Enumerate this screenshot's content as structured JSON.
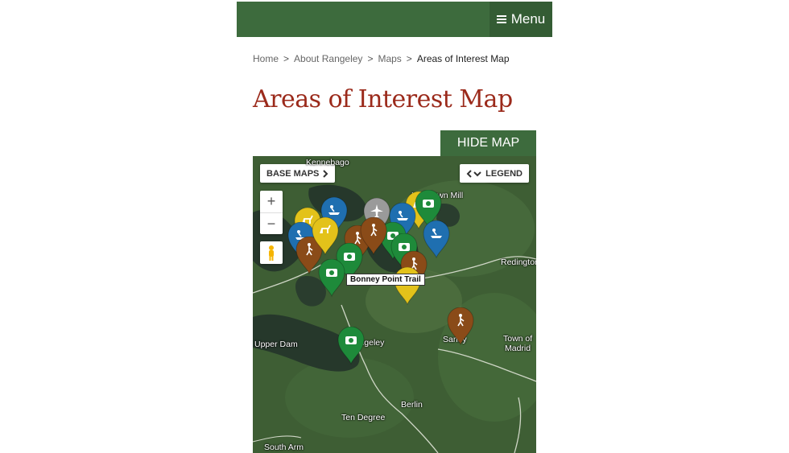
{
  "header": {
    "menu_label": "Menu"
  },
  "breadcrumb": {
    "items": [
      "Home",
      "About Rangeley",
      "Maps"
    ],
    "current": "Areas of Interest Map",
    "separator": ">"
  },
  "page_title": "Areas of Interest Map",
  "map_controls": {
    "hide_map_label": "HIDE MAP",
    "base_maps_label": "BASE MAPS",
    "legend_label": "LEGEND",
    "zoom_in": "+",
    "zoom_out": "−"
  },
  "map": {
    "places": [
      "Kennebago",
      "Langtown Mill",
      "Redington",
      "Upper Dam",
      "Town of",
      "Madrid",
      "Rangeley",
      "Berlin",
      "Ten Degree",
      "South Arm",
      "Sandy"
    ],
    "tooltip": "Bonney Point Trail",
    "marker_colors": {
      "camping": "#1f6fb0",
      "hiking": "#8a4b18",
      "photo": "#1e8a3a",
      "wildlife": "#e3c21a",
      "airport": "#9a9a9a",
      "recreation": "#1a5aa0"
    }
  }
}
